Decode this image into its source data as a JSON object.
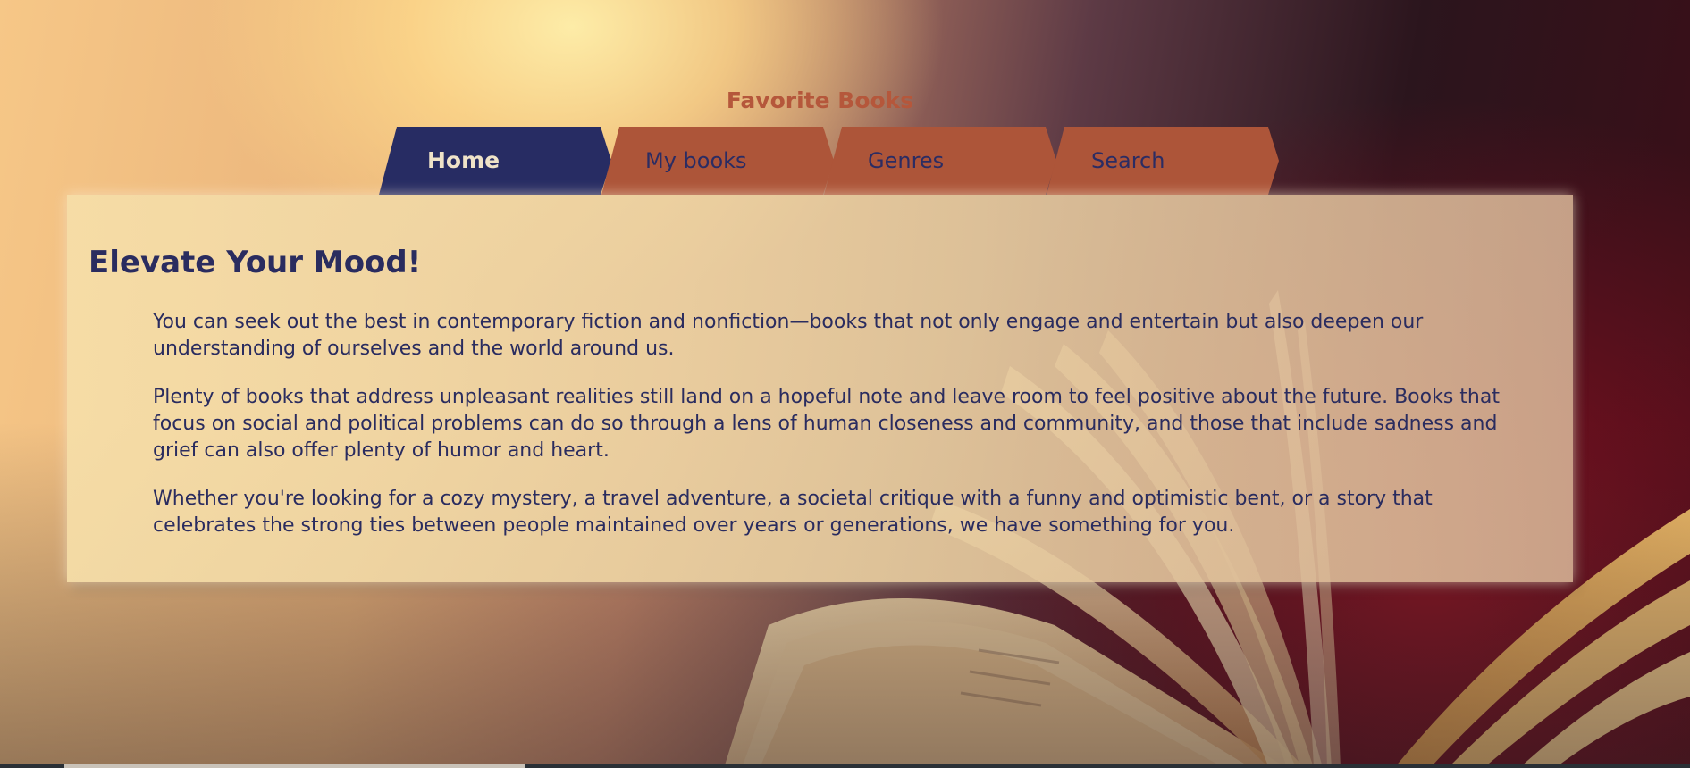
{
  "site": {
    "title": "Favorite Books"
  },
  "nav": {
    "tabs": [
      {
        "label": "Home",
        "active": true
      },
      {
        "label": "My books",
        "active": false
      },
      {
        "label": "Genres",
        "active": false
      },
      {
        "label": "Search",
        "active": false
      }
    ]
  },
  "main": {
    "heading": "Elevate Your Mood!",
    "paragraphs": [
      "You can seek out the best in contemporary fiction and nonfiction—books that not only engage and entertain but also deepen our understanding of ourselves and the world around us.",
      "Plenty of books that address unpleasant realities still land on a hopeful note and leave room to feel positive about the future. Books that focus on social and political problems can do so through a lens of human closeness and community, and those that include sadness and grief can also offer plenty of humor and heart.",
      "Whether you're looking for a cozy mystery, a travel adventure, a societal critique with a funny and optimistic bent, or a story that celebrates the strong ties between people maintained over years or generations, we have something for you."
    ]
  },
  "colors": {
    "accent_navy": "#272c63",
    "accent_rust": "#ad5539",
    "title_rust": "#b5573b",
    "panel_cream": "#f4dcaa",
    "text_navy": "#2a2c5f",
    "active_tab_text": "#efe3c8"
  },
  "background": {
    "image": "open-book-photo"
  }
}
